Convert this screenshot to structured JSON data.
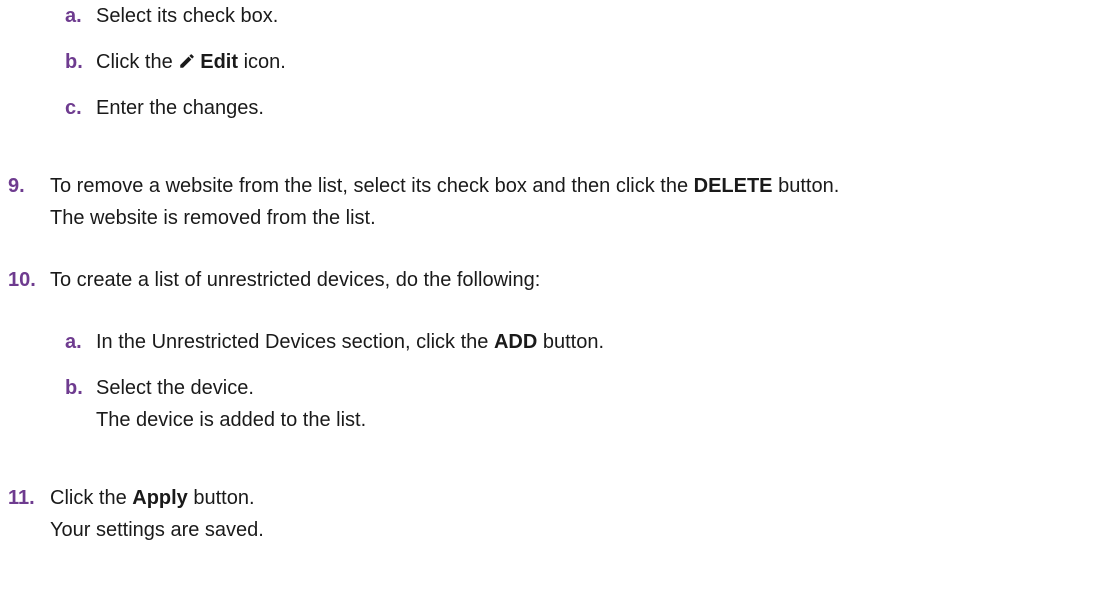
{
  "steps": {
    "a1": {
      "marker": "a.",
      "text": "Select its check box."
    },
    "b1": {
      "marker": "b.",
      "pre": "Click the ",
      "bold": "Edit",
      "post": " icon.",
      "icon": "pencil-icon"
    },
    "c1": {
      "marker": "c.",
      "text": "Enter the changes."
    },
    "s9": {
      "marker": "9.",
      "pre": "To remove a website from the list, select its check box and then click the ",
      "bold": "DELETE",
      "post": " button.",
      "result": "The website is removed from the list."
    },
    "s10": {
      "marker": "10.",
      "text": "To create a list of unrestricted devices, do the following:"
    },
    "a2": {
      "marker": "a.",
      "pre": "In the Unrestricted Devices section, click the ",
      "bold": "ADD",
      "post": " button."
    },
    "b2": {
      "marker": "b.",
      "text": "Select the device.",
      "result": "The device is added to the list."
    },
    "s11": {
      "marker": "11.",
      "pre": "Click the ",
      "bold": "Apply",
      "post": " button.",
      "result": "Your settings are saved."
    }
  },
  "colors": {
    "step_number": "#6e3b8f",
    "body_text": "#1a1a1a"
  }
}
